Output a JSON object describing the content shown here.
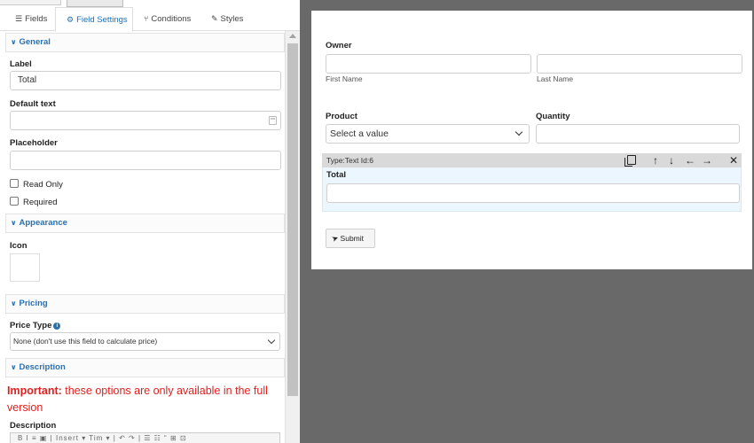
{
  "tabs": [
    {
      "label": "Fields",
      "icon": "list-icon"
    },
    {
      "label": "Field Settings",
      "icon": "gear-icon"
    },
    {
      "label": "Conditions",
      "icon": "branch-icon"
    },
    {
      "label": "Styles",
      "icon": "brush-icon"
    }
  ],
  "sections": {
    "general": "General",
    "appearance": "Appearance",
    "pricing": "Pricing",
    "description": "Description"
  },
  "general": {
    "label_title": "Label",
    "label_value": "Total",
    "default_title": "Default text",
    "default_value": "",
    "placeholder_title": "Placeholder",
    "placeholder_value": "",
    "read_only": "Read Only",
    "required": "Required"
  },
  "appearance": {
    "icon_title": "Icon"
  },
  "pricing": {
    "price_type_title": "Price Type",
    "price_type_value": "None (don't use this field to calculate price)"
  },
  "description": {
    "important_bold": "Important:",
    "important_text": " these options are only available in the full version",
    "description_title": "Description",
    "toolbar_text": "B I ≡ ▣ | Insert ▾ Tim ▾ | ↶ ↷ | ☰ ☷ “ ⊞ ⊡"
  },
  "form": {
    "owner_label": "Owner",
    "first_name": "First Name",
    "last_name": "Last Name",
    "product_label": "Product",
    "product_value": "Select a value",
    "quantity_label": "Quantity",
    "field_type": "Type:Text Id:6",
    "total_label": "Total",
    "submit_label": "Submit"
  },
  "colors": {
    "accent": "#2a6fae",
    "important": "#e02020",
    "canvas_bg": "#696969",
    "selected_field_bg": "#ebf6fe"
  }
}
